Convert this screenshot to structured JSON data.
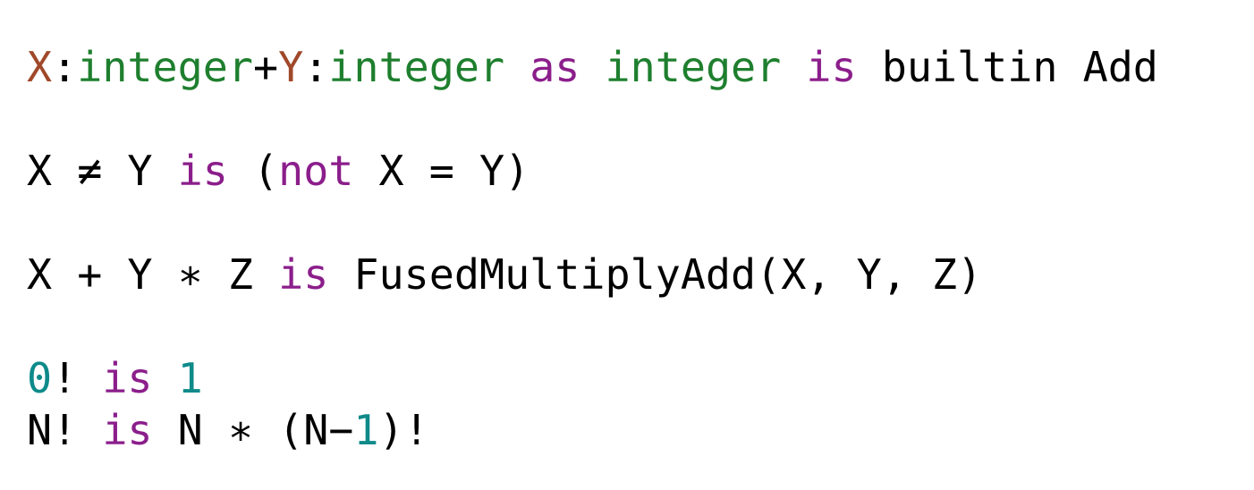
{
  "colors": {
    "plain": "#000000",
    "keyword": "#8B1E8B",
    "type": "#1E7F2E",
    "variable": "#A0482A",
    "number": "#0E8A8A"
  },
  "lines": [
    {
      "blank_after": true,
      "tokens": [
        {
          "text": "X",
          "kind": "variable"
        },
        {
          "text": ":",
          "kind": "plain"
        },
        {
          "text": "integer",
          "kind": "type"
        },
        {
          "text": "+",
          "kind": "plain"
        },
        {
          "text": "Y",
          "kind": "variable"
        },
        {
          "text": ":",
          "kind": "plain"
        },
        {
          "text": "integer",
          "kind": "type"
        },
        {
          "text": " ",
          "kind": "plain"
        },
        {
          "text": "as",
          "kind": "keyword"
        },
        {
          "text": " ",
          "kind": "plain"
        },
        {
          "text": "integer",
          "kind": "type"
        },
        {
          "text": " ",
          "kind": "plain"
        },
        {
          "text": "is",
          "kind": "keyword"
        },
        {
          "text": " builtin Add",
          "kind": "plain"
        }
      ]
    },
    {
      "blank_after": true,
      "tokens": [
        {
          "text": "X ≠ Y ",
          "kind": "plain"
        },
        {
          "text": "is",
          "kind": "keyword"
        },
        {
          "text": " (",
          "kind": "plain"
        },
        {
          "text": "not",
          "kind": "keyword"
        },
        {
          "text": " X = Y)",
          "kind": "plain"
        }
      ]
    },
    {
      "blank_after": true,
      "tokens": [
        {
          "text": "X + Y ∗ Z ",
          "kind": "plain"
        },
        {
          "text": "is",
          "kind": "keyword"
        },
        {
          "text": " FusedMultiplyAdd(X, Y, Z)",
          "kind": "plain"
        }
      ]
    },
    {
      "blank_after": false,
      "tokens": [
        {
          "text": "0",
          "kind": "number"
        },
        {
          "text": "! ",
          "kind": "plain"
        },
        {
          "text": "is",
          "kind": "keyword"
        },
        {
          "text": " ",
          "kind": "plain"
        },
        {
          "text": "1",
          "kind": "number"
        }
      ]
    },
    {
      "blank_after": false,
      "tokens": [
        {
          "text": "N! ",
          "kind": "plain"
        },
        {
          "text": "is",
          "kind": "keyword"
        },
        {
          "text": " N ∗ (N−",
          "kind": "plain"
        },
        {
          "text": "1",
          "kind": "number"
        },
        {
          "text": ")!",
          "kind": "plain"
        }
      ]
    }
  ]
}
